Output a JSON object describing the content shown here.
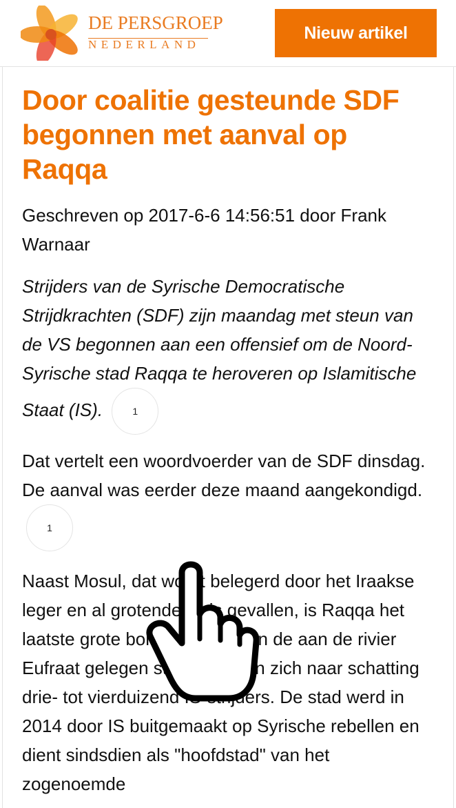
{
  "header": {
    "logo_line1": "DE PERSGROEP",
    "logo_line2": "NEDERLAND",
    "new_article_button": "Nieuw artikel"
  },
  "article": {
    "title": "Door coalitie gesteunde SDF begonnen met aanval op Raqqa",
    "meta": "Geschreven op 2017-6-6 14:56:51 door Frank Warnaar",
    "lead": "Strijders van de Syrische Democratische Strijdkrachten (SDF) zijn maandag met steun van de VS begonnen aan een offensief om de Noord-Syrische stad Raqqa te heroveren op Islamitische Staat (IS).",
    "lead_badge": "1",
    "para1": "Dat vertelt een woordvoerder van de SDF dinsdag. De aanval was eerder deze maand aangekondigd.",
    "para1_badge": "1",
    "para2": "Naast Mosul, dat wordt belegerd door het Iraakse leger en al grotendeels is gevallen, is Raqqa het laatste grote bolwerk van IS. In de aan de rivier Eufraat gelegen stad bevinden zich naar schatting drie- tot vierduizend IS-strijders. De stad werd in 2014 door IS buitgemaakt op Syrische rebellen en dient sindsdien als \"hoofdstad\" van het zogenoemde"
  },
  "colors": {
    "accent": "#ee7203",
    "logo": "#e97b21"
  },
  "icons": {
    "logo": "flower-logo-icon",
    "cursor": "hand-pointer-icon"
  }
}
